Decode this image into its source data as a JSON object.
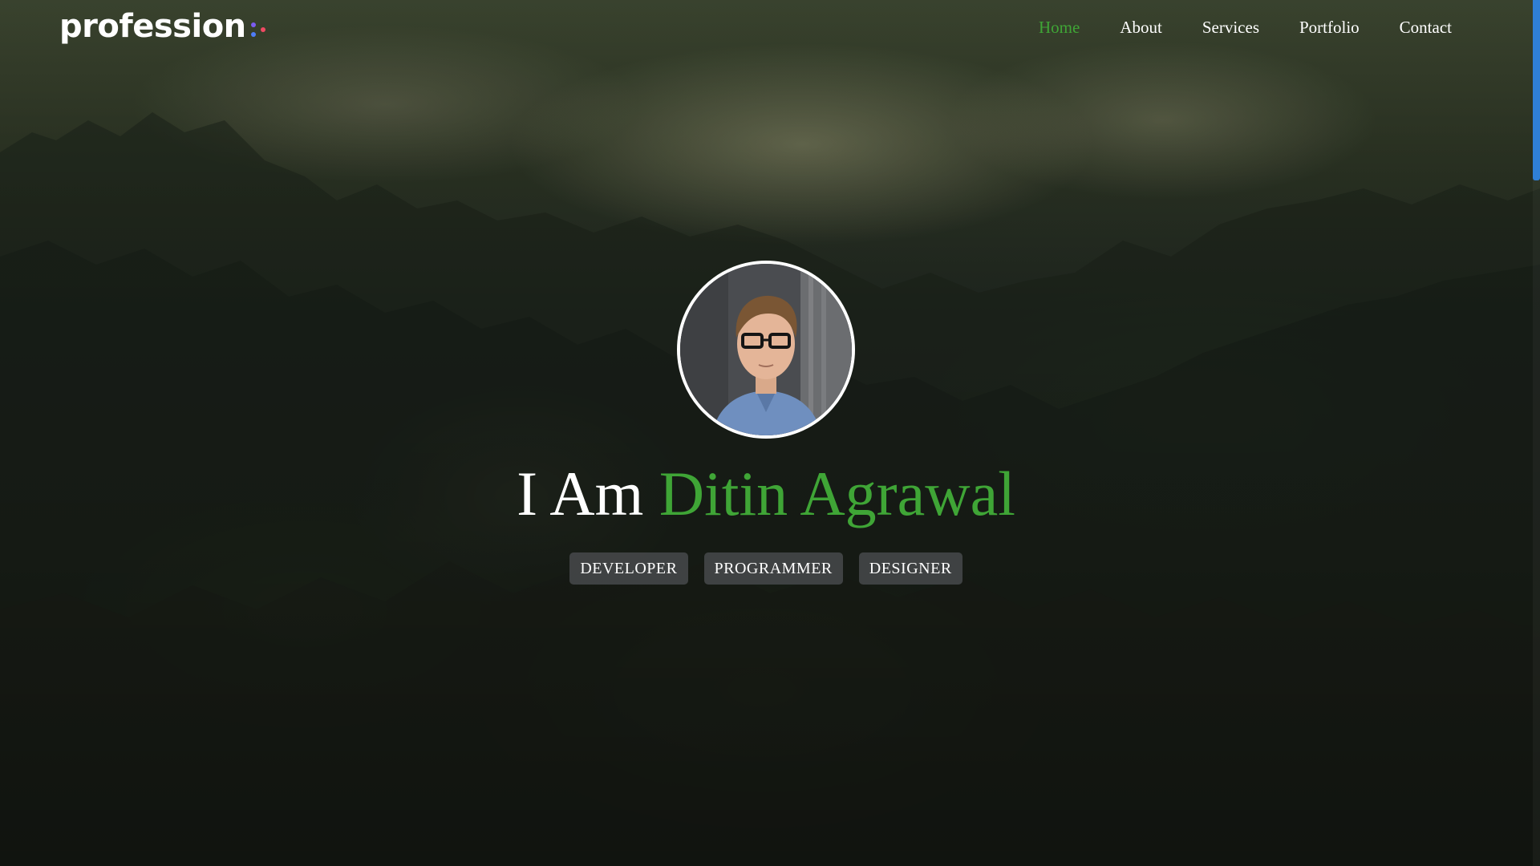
{
  "header": {
    "logo_text": "profession",
    "logo_dot_colors": [
      "#7b5cf0",
      "#4f7cf7",
      "#f04a63"
    ],
    "nav": [
      {
        "label": "Home",
        "active": true
      },
      {
        "label": "About",
        "active": false
      },
      {
        "label": "Services",
        "active": false
      },
      {
        "label": "Portfolio",
        "active": false
      },
      {
        "label": "Contact",
        "active": false
      }
    ]
  },
  "hero": {
    "greeting": "I Am",
    "name": "Ditin Agrawal",
    "tags": [
      "DEVELOPER",
      "PROGRAMMER",
      "DESIGNER"
    ]
  },
  "colors": {
    "accent": "#3fa536",
    "text": "#ffffff",
    "scrollbar_thumb": "#2f7fd6"
  }
}
